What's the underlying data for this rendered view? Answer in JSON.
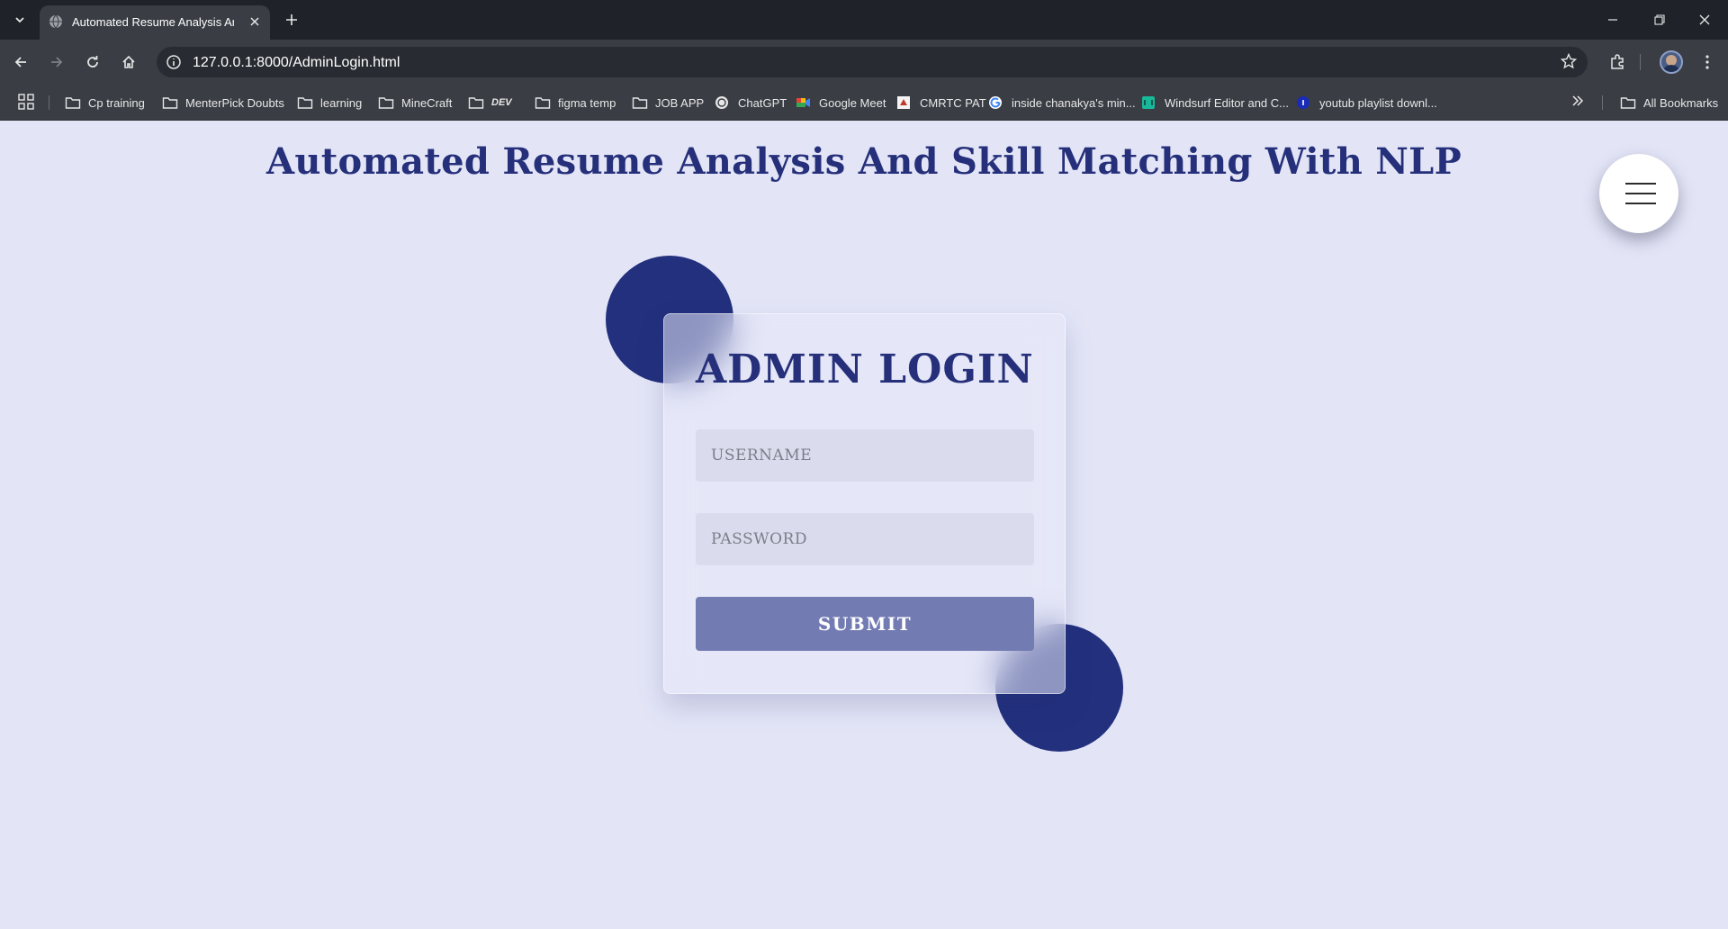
{
  "browser": {
    "tab_title": "Automated Resume Analysis And Skill Matching With NLP",
    "url": "127.0.0.1:8000/AdminLogin.html",
    "icons": [
      "chevron-down-icon",
      "globe-icon",
      "close-icon",
      "plus-icon",
      "minimize-icon",
      "restore-icon",
      "back-icon",
      "forward-icon",
      "reload-icon",
      "home-icon",
      "info-icon",
      "star-icon",
      "extensions-icon",
      "kebab-menu-icon",
      "apps-grid-icon",
      "folder-icon",
      "chevron-double-right-icon"
    ]
  },
  "bookmarks": {
    "items": [
      {
        "label": "Cp training",
        "icon": "folder-icon"
      },
      {
        "label": "MenterPick Doubts",
        "icon": "folder-icon"
      },
      {
        "label": "learning",
        "icon": "folder-icon"
      },
      {
        "label": "MineCraft",
        "icon": "folder-icon"
      },
      {
        "label": "DEV",
        "icon": "folder-icon"
      },
      {
        "label": "figma temp",
        "icon": "folder-icon"
      },
      {
        "label": "JOB APP",
        "icon": "folder-icon"
      },
      {
        "label": "ChatGPT",
        "icon": "chatgpt-icon"
      },
      {
        "label": "Google Meet",
        "icon": "google-meet-icon"
      },
      {
        "label": "CMRTC PAT",
        "icon": "site-icon"
      },
      {
        "label": "inside chanakya's min...",
        "icon": "google-icon"
      },
      {
        "label": "Windsurf Editor and C...",
        "icon": "windsurf-icon"
      },
      {
        "label": "youtub playlist downl...",
        "icon": "site-icon"
      }
    ],
    "all_bookmarks": "All Bookmarks"
  },
  "page": {
    "title": "Automated Resume Analysis And Skill Matching With NLP",
    "login": {
      "heading": "ADMIN LOGIN",
      "username_placeholder": "USERNAME",
      "password_placeholder": "PASSWORD",
      "submit_label": "SUBMIT"
    }
  },
  "colors": {
    "page_background": "#e3e5f7",
    "accent_navy": "#22307d",
    "heading_text": "#26307a",
    "submit_button": "#737bb3",
    "input_background": "#dadcee"
  }
}
